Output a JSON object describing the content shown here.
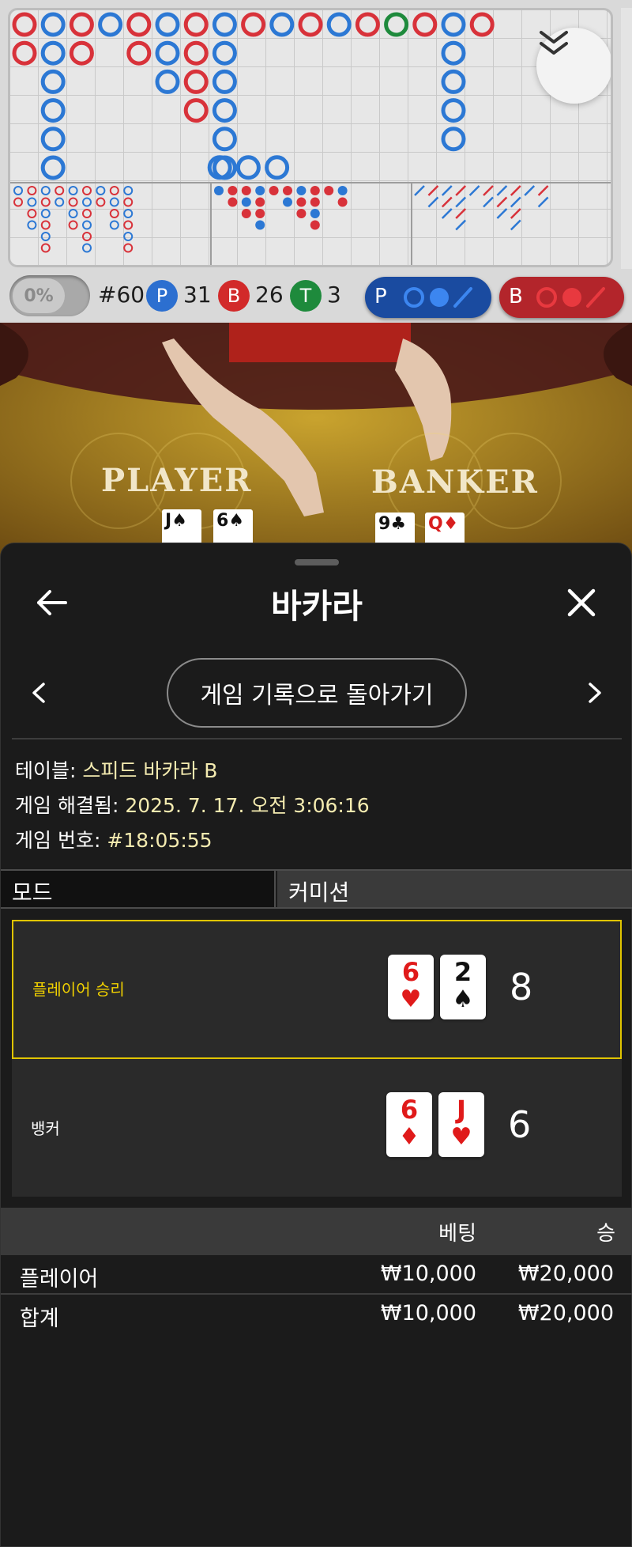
{
  "stats": {
    "percent": "0%",
    "round": "#60",
    "player": {
      "letter": "P",
      "count": "31",
      "color": "#2c6fd0"
    },
    "banker": {
      "letter": "B",
      "count": "26",
      "color": "#d22a2a"
    },
    "tie": {
      "letter": "T",
      "count": "3",
      "color": "#1e8a3c"
    },
    "predict_player_label": "P",
    "predict_banker_label": "B"
  },
  "video": {
    "player_label": "PLAYER",
    "banker_label": "BANKER",
    "player_cards": [
      {
        "rank": "J",
        "suit": "♠"
      },
      {
        "rank": "6",
        "suit": "♠"
      }
    ],
    "banker_cards": [
      {
        "rank": "9",
        "suit": "♣"
      },
      {
        "rank": "Q",
        "suit": "♦"
      }
    ]
  },
  "sheet": {
    "title": "바카라",
    "return_button": "게임 기록으로 돌아가기",
    "table_label": "테이블:",
    "table_value": "스피드 바카라 B",
    "resolved_label": "게임 해결됨:",
    "resolved_value": "2025. 7. 17. 오전 3:06:16",
    "game_no_label": "게임 번호:",
    "game_no_value": "#18:05:55",
    "mode_label": "모드",
    "commission_label": "커미션"
  },
  "result": {
    "player": {
      "label": "플레이어 승리",
      "score": "8",
      "cards": [
        {
          "rank": "6",
          "suit": "♥",
          "color": "red"
        },
        {
          "rank": "2",
          "suit": "♠",
          "color": "black"
        }
      ]
    },
    "banker": {
      "label": "뱅커",
      "score": "6",
      "cards": [
        {
          "rank": "6",
          "suit": "♦",
          "color": "red"
        },
        {
          "rank": "J",
          "suit": "♥",
          "color": "red"
        }
      ]
    },
    "winner_color": "#f0d000"
  },
  "bets": {
    "col_bet": "베팅",
    "col_win": "승",
    "rows": [
      {
        "name": "플레이어",
        "bet": "₩10,000",
        "win": "₩20,000"
      },
      {
        "name": "합계",
        "bet": "₩10,000",
        "win": "₩20,000"
      }
    ]
  },
  "icons": {
    "collapse": "chevron-double-down-icon",
    "back": "arrow-left-icon",
    "close": "close-icon",
    "prev": "chevron-left-icon",
    "next": "chevron-right-icon"
  }
}
